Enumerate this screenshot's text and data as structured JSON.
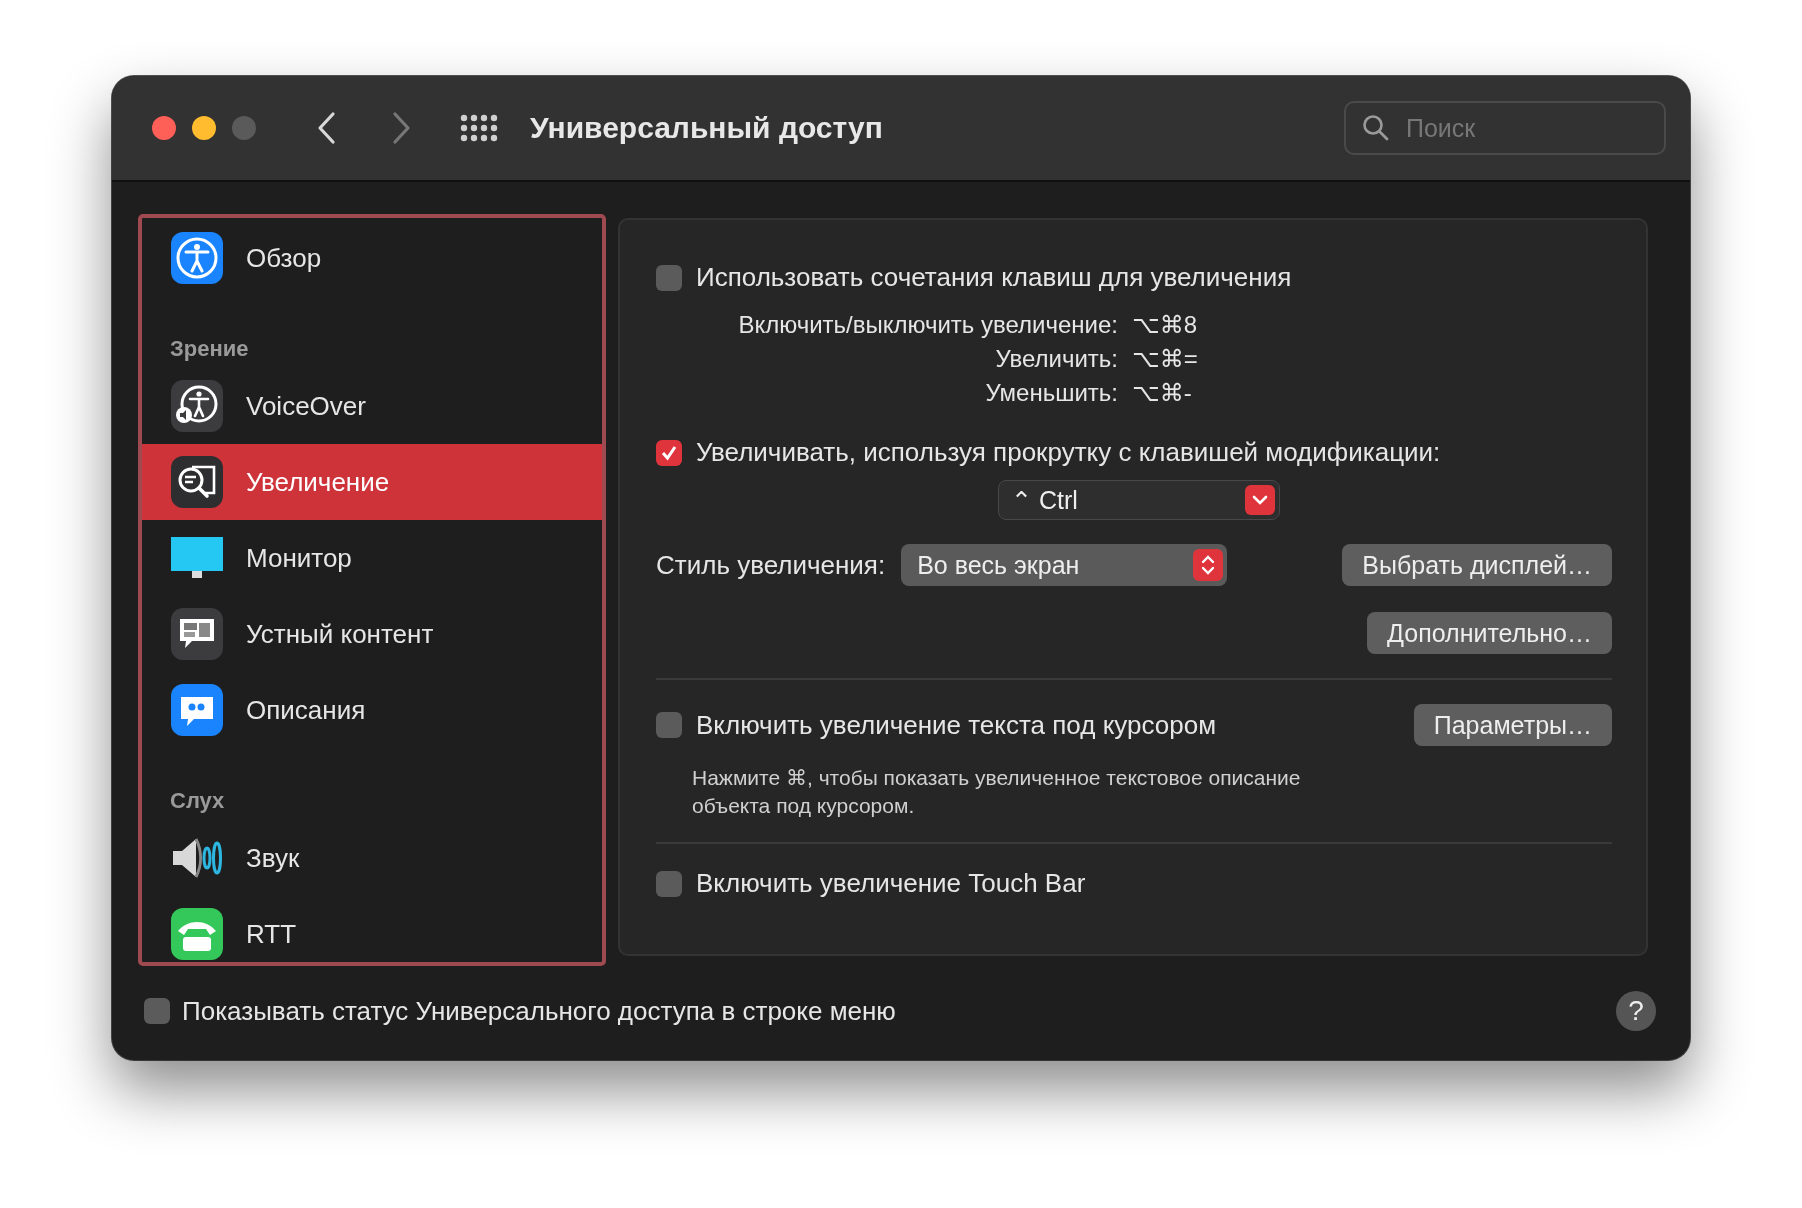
{
  "window": {
    "title": "Универсальный доступ",
    "search": {
      "placeholder": "Поиск"
    }
  },
  "sidebar": {
    "items": [
      {
        "kind": "item",
        "label": "Обзор",
        "selected": false
      },
      {
        "kind": "header",
        "label": "Зрение"
      },
      {
        "kind": "item",
        "label": "VoiceOver",
        "selected": false
      },
      {
        "kind": "item",
        "label": "Увеличение",
        "selected": true
      },
      {
        "kind": "item",
        "label": "Монитор",
        "selected": false
      },
      {
        "kind": "item",
        "label": "Устный контент",
        "selected": false
      },
      {
        "kind": "item",
        "label": "Описания",
        "selected": false
      },
      {
        "kind": "header",
        "label": "Слух"
      },
      {
        "kind": "item",
        "label": "Звук",
        "selected": false
      },
      {
        "kind": "item",
        "label": "RTT",
        "selected": false
      }
    ]
  },
  "panel": {
    "shortcuts_checkbox": {
      "label": "Использовать сочетания клавиш для увеличения",
      "checked": false
    },
    "shortcuts": [
      {
        "label": "Включить/выключить увеличение:",
        "keys": "⌥⌘8"
      },
      {
        "label": "Увеличить:",
        "keys": "⌥⌘="
      },
      {
        "label": "Уменьшить:",
        "keys": "⌥⌘-"
      }
    ],
    "scroll_checkbox": {
      "label": "Увеличивать, используя прокрутку с клавишей модификации:",
      "checked": true
    },
    "modifier_popup": {
      "value": "⌃ Ctrl"
    },
    "style_label": "Стиль увеличения:",
    "style_popup": {
      "value": "Во весь экран"
    },
    "choose_display_button": "Выбрать дисплей…",
    "advanced_button": "Дополнительно…",
    "hover_checkbox": {
      "label": "Включить увеличение текста под курсором",
      "checked": false
    },
    "hover_options_button": "Параметры…",
    "hover_description": "Нажмите ⌘, чтобы показать увеличенное текстовое описание объекта под курсором.",
    "touchbar_checkbox": {
      "label": "Включить увеличение Touch Bar",
      "checked": false
    }
  },
  "footer": {
    "status_checkbox": {
      "label": "Показывать статус Универсального доступа в строке меню",
      "checked": false
    },
    "help": "?"
  }
}
